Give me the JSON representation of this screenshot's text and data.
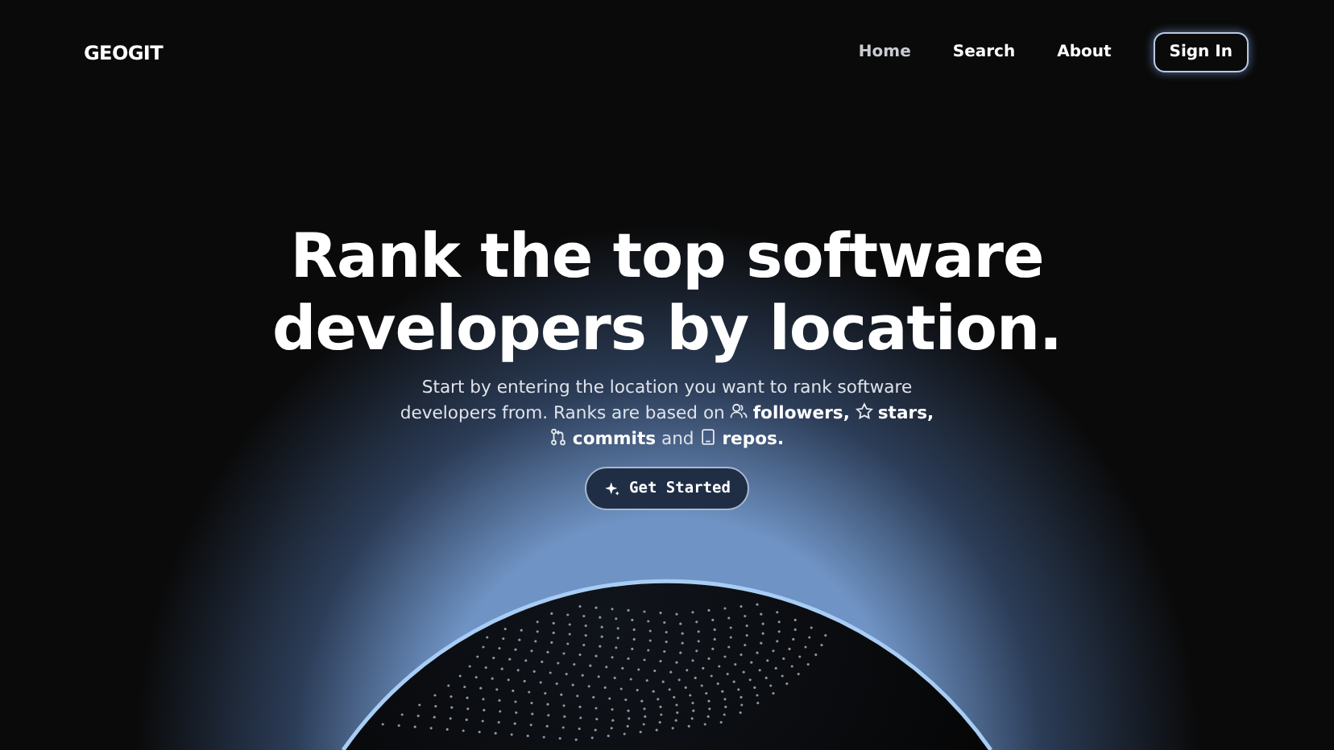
{
  "nav": {
    "logo": "GEOGIT",
    "links": [
      {
        "label": "Home",
        "selected": true
      },
      {
        "label": "Search",
        "selected": false
      },
      {
        "label": "About",
        "selected": false
      }
    ],
    "sign_in": "Sign In"
  },
  "hero": {
    "headline": [
      "Rank the top software",
      "developers by location."
    ],
    "description": [
      {
        "kind": "text",
        "text": "Start by entering the location you want to rank software developers from. Ranks are based on"
      },
      {
        "kind": "stat",
        "label": "followers,"
      },
      {
        "kind": "stat",
        "label": "stars,"
      },
      {
        "kind": "stat",
        "label": "commits"
      },
      {
        "kind": "text",
        "text": "and"
      },
      {
        "kind": "stat",
        "label": "repos."
      }
    ],
    "cta": "Get Started"
  }
}
